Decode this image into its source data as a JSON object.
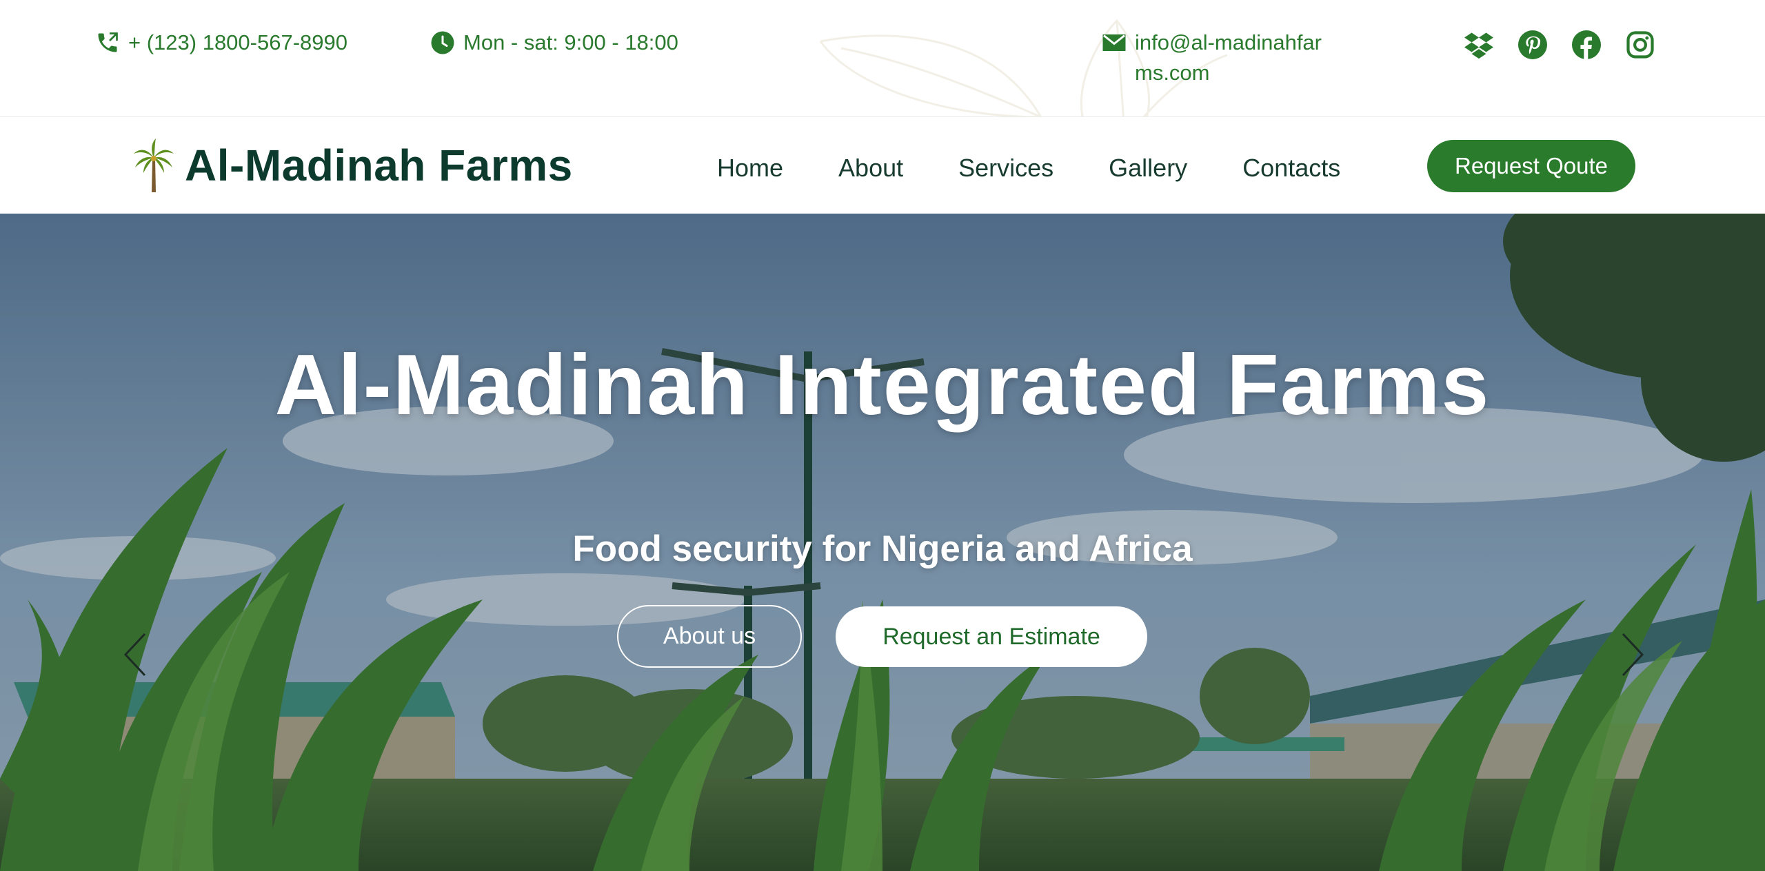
{
  "topbar": {
    "phone": "+ (123) 1800-567-8990",
    "hours": "Mon - sat: 9:00 - 18:00",
    "email": "info@al-madinahfarms.com",
    "socials": [
      "dropbox-icon",
      "pinterest-icon",
      "facebook-icon",
      "instagram-icon"
    ]
  },
  "navbar": {
    "brand": "Al-Madinah Farms",
    "menu": [
      "Home",
      "About",
      "Services",
      "Gallery",
      "Contacts"
    ],
    "cta": "Request Qoute"
  },
  "hero": {
    "title": "Al-Madinah Integrated Farms",
    "subtitle": "Food security for Nigeria and Africa",
    "buttons": {
      "about": "About us",
      "estimate": "Request an Estimate"
    }
  },
  "colors": {
    "accent_green": "#2b7b2d",
    "brand_dark": "#0c3b2e",
    "nav_text": "#173b2f"
  }
}
